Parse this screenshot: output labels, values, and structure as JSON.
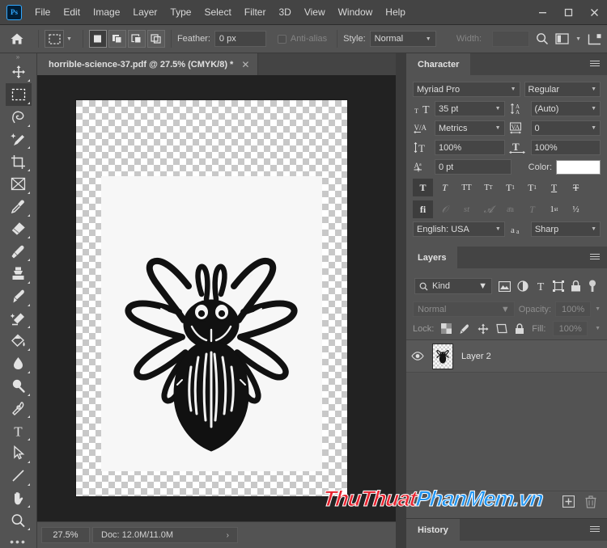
{
  "app": {
    "logo": "Ps",
    "menus": [
      "File",
      "Edit",
      "Image",
      "Layer",
      "Type",
      "Select",
      "Filter",
      "3D",
      "View",
      "Window",
      "Help"
    ],
    "window_controls": {
      "minimize": "–",
      "maximize": "❐",
      "close": "✕"
    }
  },
  "options_bar": {
    "home_icon": "home-icon",
    "tool_preset_icon": "rectangular-marquee-icon",
    "selection_modes": [
      "new-selection",
      "add-to-selection",
      "subtract-from-selection",
      "intersect-selection"
    ],
    "feather_label": "Feather:",
    "feather_value": "0 px",
    "antialias_label": "Anti-alias",
    "antialias_checked": false,
    "style_label": "Style:",
    "style_value": "Normal",
    "width_label": "Width:",
    "width_value": "",
    "search_icon": "search-icon",
    "workspace_icon": "workspace-icon",
    "arrange_icon": "arrange-documents-icon"
  },
  "document_tab": {
    "title": "horrible-science-37.pdf @ 27.5% (CMYK/8) *",
    "close": "✕",
    "left_arrows": "»",
    "right_arrows": "»"
  },
  "toolbar": {
    "grip": "»",
    "tools": [
      {
        "name": "move-tool",
        "active": false
      },
      {
        "name": "rectangular-marquee-tool",
        "active": true
      },
      {
        "name": "lasso-tool",
        "active": false
      },
      {
        "name": "quick-selection-tool",
        "active": false
      },
      {
        "name": "crop-tool",
        "active": false
      },
      {
        "name": "frame-tool",
        "active": false
      },
      {
        "name": "eyedropper-tool",
        "active": false
      },
      {
        "name": "spot-healing-brush-tool",
        "active": false
      },
      {
        "name": "brush-tool",
        "active": false
      },
      {
        "name": "clone-stamp-tool",
        "active": false
      },
      {
        "name": "history-brush-tool",
        "active": false
      },
      {
        "name": "eraser-tool",
        "active": false
      },
      {
        "name": "gradient-tool",
        "active": false
      },
      {
        "name": "blur-tool",
        "active": false
      },
      {
        "name": "dodge-tool",
        "active": false
      },
      {
        "name": "pen-tool",
        "active": false
      },
      {
        "name": "type-tool",
        "active": false
      },
      {
        "name": "path-selection-tool",
        "active": false
      },
      {
        "name": "line-tool",
        "active": false
      },
      {
        "name": "hand-tool",
        "active": false
      },
      {
        "name": "zoom-tool",
        "active": false
      }
    ],
    "more_tools": "•••"
  },
  "canvas": {
    "artwork_alt": "spider-illustration"
  },
  "status_bar": {
    "zoom": "27.5%",
    "doc_label": "Doc: 12.0M/11.0M",
    "expand_arrow": "›"
  },
  "character_panel": {
    "tab_label": "Character",
    "menu_icon": "panel-menu-icon",
    "font_family": "Myriad Pro",
    "font_style": "Regular",
    "font_size_icon": "font-size-icon",
    "font_size": "35 pt",
    "leading_icon": "leading-icon",
    "leading": "(Auto)",
    "kerning_icon": "kerning-icon",
    "kerning": "Metrics",
    "tracking_icon": "tracking-icon",
    "tracking": "0",
    "vertical_scale_icon": "vertical-scale-icon",
    "vertical_scale": "100%",
    "horizontal_scale_icon": "horizontal-scale-icon",
    "horizontal_scale": "100%",
    "baseline_icon": "baseline-shift-icon",
    "baseline_shift": "0 pt",
    "color_label": "Color:",
    "color_value": "#ffffff",
    "style_buttons": [
      {
        "name": "faux-bold",
        "glyph": "T",
        "on": true
      },
      {
        "name": "faux-italic",
        "glyph": "T",
        "on": false
      },
      {
        "name": "all-caps",
        "glyph": "TT",
        "on": false
      },
      {
        "name": "small-caps",
        "glyph": "Tᴛ",
        "on": false
      },
      {
        "name": "superscript",
        "glyph": "T¹",
        "on": false
      },
      {
        "name": "subscript",
        "glyph": "T₁",
        "on": false
      },
      {
        "name": "underline",
        "glyph": "T",
        "on": false
      },
      {
        "name": "strikethrough",
        "glyph": "T",
        "on": false
      }
    ],
    "opentype_buttons": [
      {
        "name": "standard-ligatures",
        "glyph": "fi",
        "on": true,
        "disabled": false
      },
      {
        "name": "contextual-alternates",
        "glyph": "σ",
        "on": false,
        "disabled": true
      },
      {
        "name": "discretionary-ligatures",
        "glyph": "st",
        "on": false,
        "disabled": true
      },
      {
        "name": "swash",
        "glyph": "Α",
        "on": false,
        "disabled": true
      },
      {
        "name": "oldstyle",
        "glyph": "aa",
        "on": false,
        "disabled": true
      },
      {
        "name": "stylistic-alternates",
        "glyph": "T",
        "on": false,
        "disabled": true
      },
      {
        "name": "ordinals",
        "glyph": "1st",
        "on": false,
        "disabled": false
      },
      {
        "name": "fractions",
        "glyph": "½",
        "on": false,
        "disabled": false
      }
    ],
    "language": "English: USA",
    "antialias_icon": "anti-alias-icon",
    "antialias_method": "Sharp"
  },
  "layers_panel": {
    "tab_label": "Layers",
    "menu_icon": "panel-menu-icon",
    "filter_icon": "search-icon",
    "filter_kind": "Kind",
    "filter_icons": [
      "pixel-layers-icon",
      "adjustment-layers-icon",
      "type-layers-icon",
      "shape-layers-icon",
      "smart-object-icon"
    ],
    "filter_toggle": "filter-toggle-icon",
    "blend_mode": "Normal",
    "opacity_label": "Opacity:",
    "opacity_value": "100%",
    "lock_label": "Lock:",
    "lock_icons": [
      "lock-transparent-pixels-icon",
      "lock-image-pixels-icon",
      "lock-position-icon",
      "lock-artboard-nesting-icon",
      "lock-all-icon"
    ],
    "fill_label": "Fill:",
    "fill_value": "100%",
    "layers": [
      {
        "name": "Layer 2",
        "visible": true,
        "thumb": "spider-thumbnail"
      }
    ],
    "footer_icons": [
      "new-layer-icon",
      "delete-layer-icon"
    ]
  },
  "history_panel": {
    "tab_label": "History",
    "menu_icon": "panel-menu-icon"
  },
  "watermark": {
    "part1": "ThuThuat",
    "part2": "PhanMem.vn",
    "color1": "#e8222e",
    "color2": "#2196f3"
  }
}
